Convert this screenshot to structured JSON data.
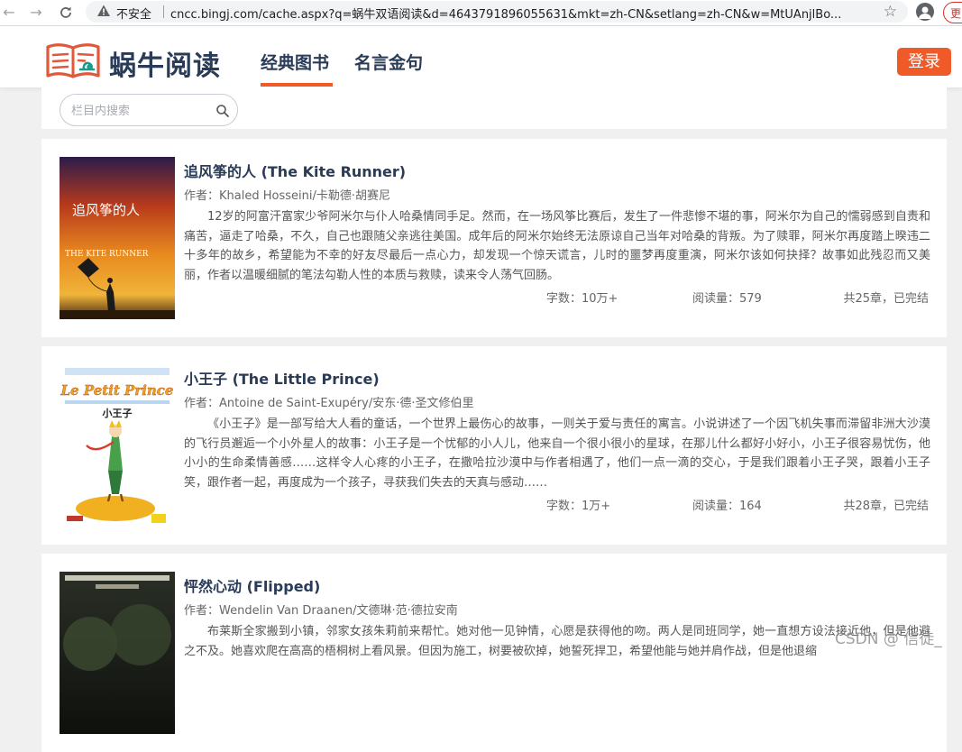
{
  "browser": {
    "security_label": "不安全",
    "url": "cncc.bingj.com/cache.aspx?q=蜗牛双语阅读&d=4643791896055631&mkt=zh-CN&setlang=zh-CN&w=MtUAnjlBo...",
    "update_label": "更"
  },
  "site": {
    "logo_text": "蜗牛阅读",
    "tabs": [
      {
        "label": "经典图书",
        "active": true
      },
      {
        "label": "名言金句",
        "active": false
      }
    ],
    "login_label": "登录",
    "accent_color": "#f05a28"
  },
  "search": {
    "placeholder": "栏目内搜索"
  },
  "books": [
    {
      "title": "追风筝的人 (The Kite Runner)",
      "author": "作者：Khaled Hosseini/卡勒德·胡赛尼",
      "description": "12岁的阿富汗富家少爷阿米尔与仆人哈桑情同手足。然而，在一场风筝比赛后，发生了一件悲惨不堪的事，阿米尔为自己的懦弱感到自责和痛苦，逼走了哈桑，不久，自己也跟随父亲逃往美国。成年后的阿米尔始终无法原谅自己当年对哈桑的背叛。为了赎罪，阿米尔再度踏上暌违二十多年的故乡，希望能为不幸的好友尽最后一点心力，却发现一个惊天谎言，儿时的噩梦再度重演，阿米尔该如何抉择？故事如此残忍而又美丽，作者以温暖细腻的笔法勾勒人性的本质与救赎，读来令人荡气回肠。",
      "words": "字数：10万+",
      "reads": "阅读量：579",
      "chapters": "共25章，已完结",
      "cover_title_cn": "追风筝的人",
      "cover_title_en": "THE KITE RUNNER"
    },
    {
      "title": "小王子 (The Little Prince)",
      "author": "作者：Antoine de Saint-Exupéry/安东·德·圣文修伯里",
      "description": "《小王子》是一部写给大人看的童话，一个世界上最伤心的故事，一则关于爱与责任的寓言。小说讲述了一个因飞机失事而滞留非洲大沙漠的飞行员邂逅一个小外星人的故事：小王子是一个忧郁的小人儿，他来自一个很小很小的星球，在那儿什么都好小好小，小王子很容易忧伤，他小小的生命柔情善感……这样令人心疼的小王子，在撒哈拉沙漠中与作者相遇了，他们一点一滴的交心，于是我们跟着小王子哭，跟着小王子笑，跟作者一起，再度成为一个孩子，寻获我们失去的天真与感动……",
      "words": "字数：1万+",
      "reads": "阅读量：164",
      "chapters": "共28章，已完结",
      "cover_title_fr": "Le Petit Prince",
      "cover_title_cn": "小王子"
    },
    {
      "title": "怦然心动 (Flipped)",
      "author": "作者：Wendelin Van Draanen/文德琳·范·德拉安南",
      "description": "布莱斯全家搬到小镇，邻家女孩朱莉前来帮忙。她对他一见钟情，心愿是获得他的吻。两人是同班同学，她一直想方设法接近他，但是他避之不及。她喜欢爬在高高的梧桐树上看风景。但因为施工，树要被砍掉，她誓死捍卫，希望他能与她并肩作战，但是他退缩",
      "words": "",
      "reads": "",
      "chapters": ""
    }
  ],
  "watermark": "CSDN @ 信徒_"
}
